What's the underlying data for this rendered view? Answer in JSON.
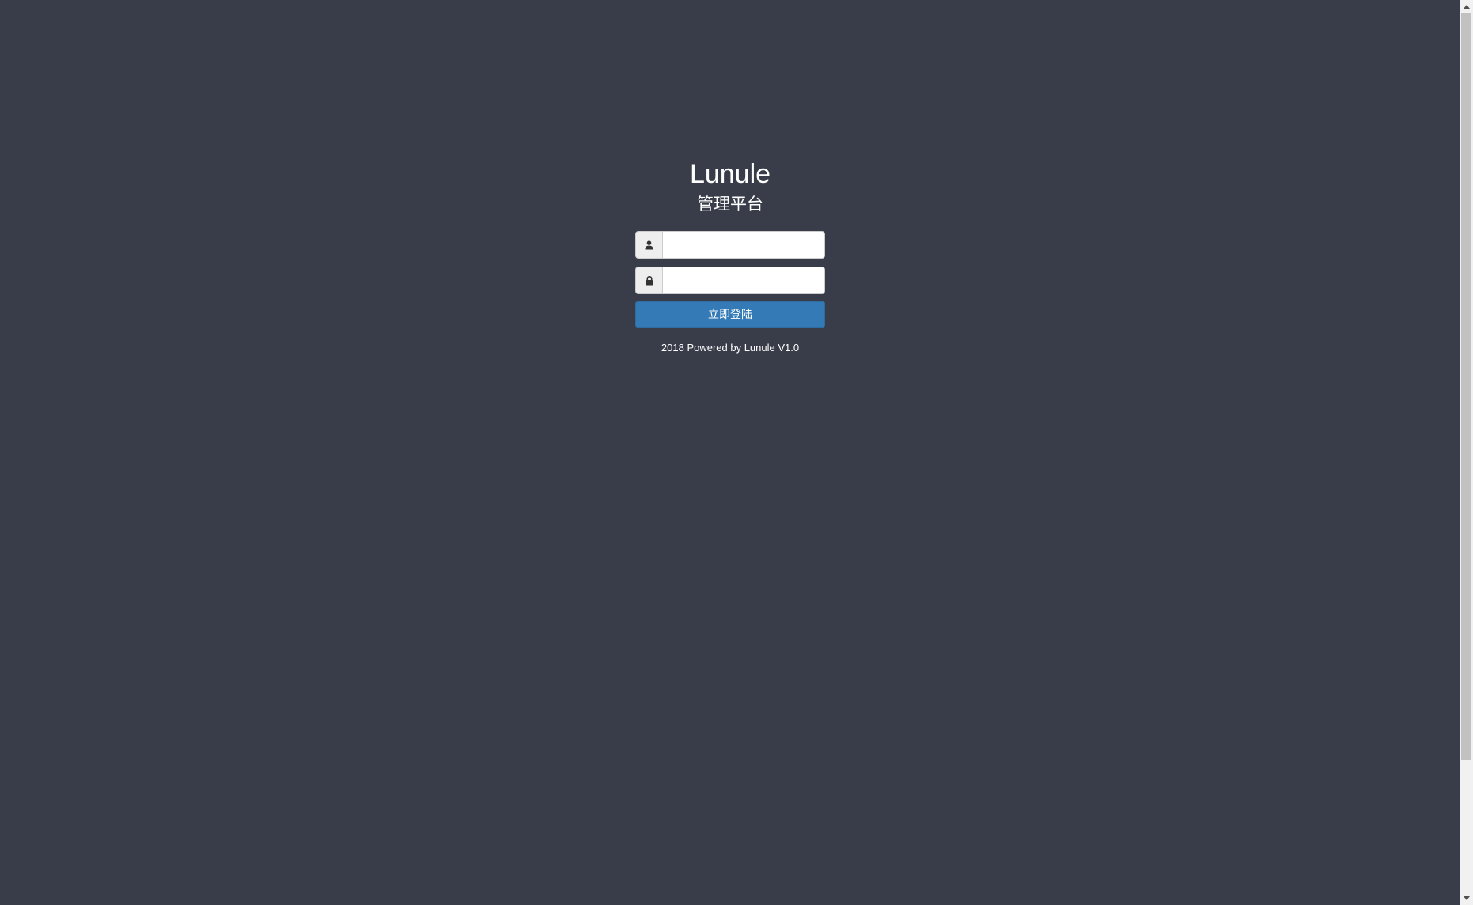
{
  "app": {
    "title": "Lunule",
    "subtitle": "管理平台"
  },
  "form": {
    "username": {
      "icon": "user-icon",
      "value": "",
      "placeholder": ""
    },
    "password": {
      "icon": "lock-icon",
      "value": "",
      "placeholder": ""
    },
    "submit_label": "立即登陆"
  },
  "footer": {
    "text": "2018 Powered by Lunule V1.0"
  },
  "colors": {
    "background": "#393d49",
    "button": "#337ab7",
    "addon": "#eeeeee"
  }
}
